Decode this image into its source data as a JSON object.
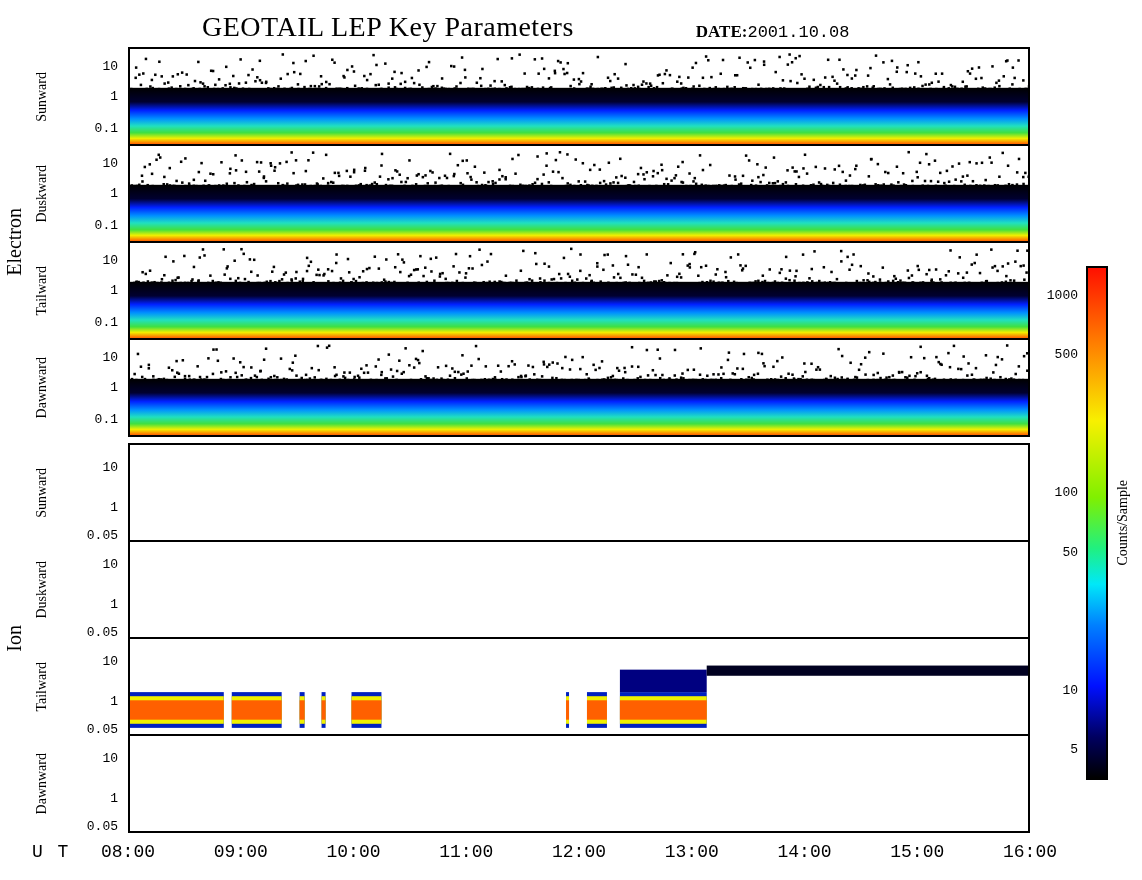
{
  "title": "GEOTAIL LEP Key Parameters",
  "date": {
    "label": "DATE:",
    "value": "2001.10.08"
  },
  "groups": [
    {
      "name": "Electron",
      "kind": "electron",
      "panels": [
        {
          "label": "Sunward",
          "kind": "band",
          "ticks": [
            "10",
            "1",
            "0.1"
          ]
        },
        {
          "label": "Duskward",
          "kind": "band",
          "ticks": [
            "10",
            "1",
            "0.1"
          ]
        },
        {
          "label": "Tailward",
          "kind": "band",
          "ticks": [
            "10",
            "1",
            "0.1"
          ]
        },
        {
          "label": "Dawnward",
          "kind": "band",
          "ticks": [
            "10",
            "1",
            "0.1"
          ]
        }
      ]
    },
    {
      "name": "Ion",
      "kind": "ion",
      "panels": [
        {
          "label": "Sunward",
          "kind": "empty",
          "ticks": [
            "10",
            "1",
            "0.05"
          ]
        },
        {
          "label": "Duskward",
          "kind": "empty",
          "ticks": [
            "10",
            "1",
            "0.05"
          ]
        },
        {
          "label": "Tailward",
          "kind": "bursts",
          "ticks": [
            "10",
            "1",
            "0.05"
          ]
        },
        {
          "label": "Dawnward",
          "kind": "empty",
          "ticks": [
            "10",
            "1",
            "0.05"
          ]
        }
      ]
    }
  ],
  "colorbar": {
    "label": "Counts/Sample",
    "ticks": [
      "1000",
      "500",
      "100",
      "50",
      "10",
      "5"
    ]
  },
  "time_axis": {
    "label": "U T",
    "ticks": [
      "08:00",
      "09:00",
      "10:00",
      "11:00",
      "12:00",
      "13:00",
      "14:00",
      "15:00",
      "16:00"
    ]
  }
}
